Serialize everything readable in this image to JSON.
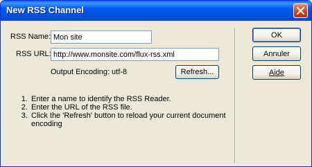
{
  "window": {
    "title": "New RSS Channel"
  },
  "form": {
    "name_label": "RSS Name:",
    "name_value": "Mon site",
    "url_label": "RSS URL:",
    "url_value": "http://www.monsite.com/flux-rss.xml",
    "encoding_label": "Output Encoding: utf-8",
    "refresh_label": "Refresh..."
  },
  "buttons": {
    "ok": "OK",
    "cancel": "Annuler",
    "help": "Aide"
  },
  "instructions": [
    "Enter a name to identify the RSS Reader.",
    "Enter the URL of the RSS file.",
    "Click the 'Refresh' button to reload your current document encoding"
  ],
  "icons": {
    "close": "close-icon"
  },
  "colors": {
    "titlebar": "#0058ee",
    "dialog_bg": "#ece9d8",
    "close_button": "#c9441d"
  }
}
